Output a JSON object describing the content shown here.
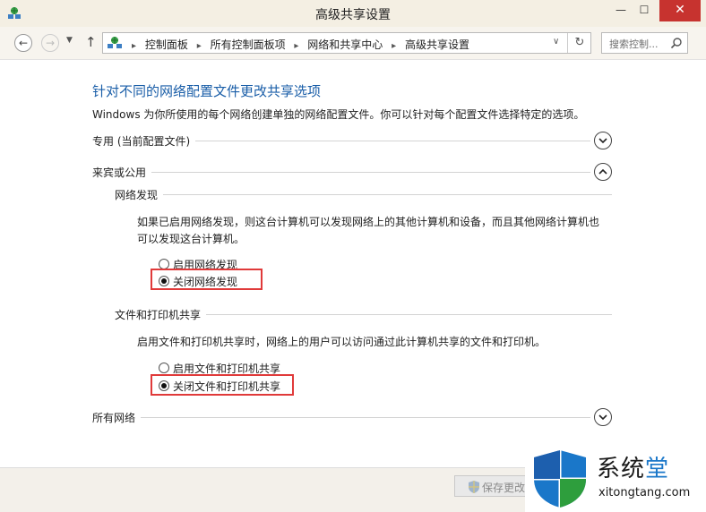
{
  "window": {
    "title": "高级共享设置",
    "min_glyph": "—",
    "max_glyph": "☐",
    "close_glyph": "✕"
  },
  "nav": {
    "breadcrumbs": [
      "控制面板",
      "所有控制面板项",
      "网络和共享中心",
      "高级共享设置"
    ],
    "search_placeholder": "搜索控制...",
    "back_glyph": "←",
    "forward_glyph": "→",
    "dropdown_glyph": "▼",
    "up_glyph": "↑",
    "address_dropdown_glyph": "∨",
    "refresh_glyph": "↻",
    "crumb_separator": "▸"
  },
  "main": {
    "heading": "针对不同的网络配置文件更改共享选项",
    "description": "Windows 为你所使用的每个网络创建单独的网络配置文件。你可以针对每个配置文件选择特定的选项。",
    "profiles": {
      "private": {
        "label": "专用 (当前配置文件)",
        "state": "collapsed"
      },
      "guest": {
        "label": "来宾或公用",
        "state": "expanded",
        "network_discovery": {
          "label": "网络发现",
          "description_line1": "如果已启用网络发现，则这台计算机可以发现网络上的其他计算机和设备，而且其他网络计算机也",
          "description_line2": "可以发现这台计算机。",
          "options": [
            {
              "label": "启用网络发现",
              "checked": false
            },
            {
              "label": "关闭网络发现",
              "checked": true
            }
          ]
        },
        "file_printer_sharing": {
          "label": "文件和打印机共享",
          "description": "启用文件和打印机共享时，网络上的用户可以访问通过此计算机共享的文件和打印机。",
          "options": [
            {
              "label": "启用文件和打印机共享",
              "checked": false
            },
            {
              "label": "关闭文件和打印机共享",
              "checked": true
            }
          ]
        }
      },
      "all": {
        "label": "所有网络",
        "state": "collapsed"
      }
    }
  },
  "footer": {
    "save_label": "保存更改"
  },
  "watermark": {
    "name_part1": "系统",
    "name_part2": "堂",
    "url": "xitongtang.com"
  },
  "colors": {
    "heading": "#1a5ea8",
    "highlight": "#e03a3a",
    "close_button": "#c7332f",
    "watermark_accent": "#1a77c9"
  }
}
